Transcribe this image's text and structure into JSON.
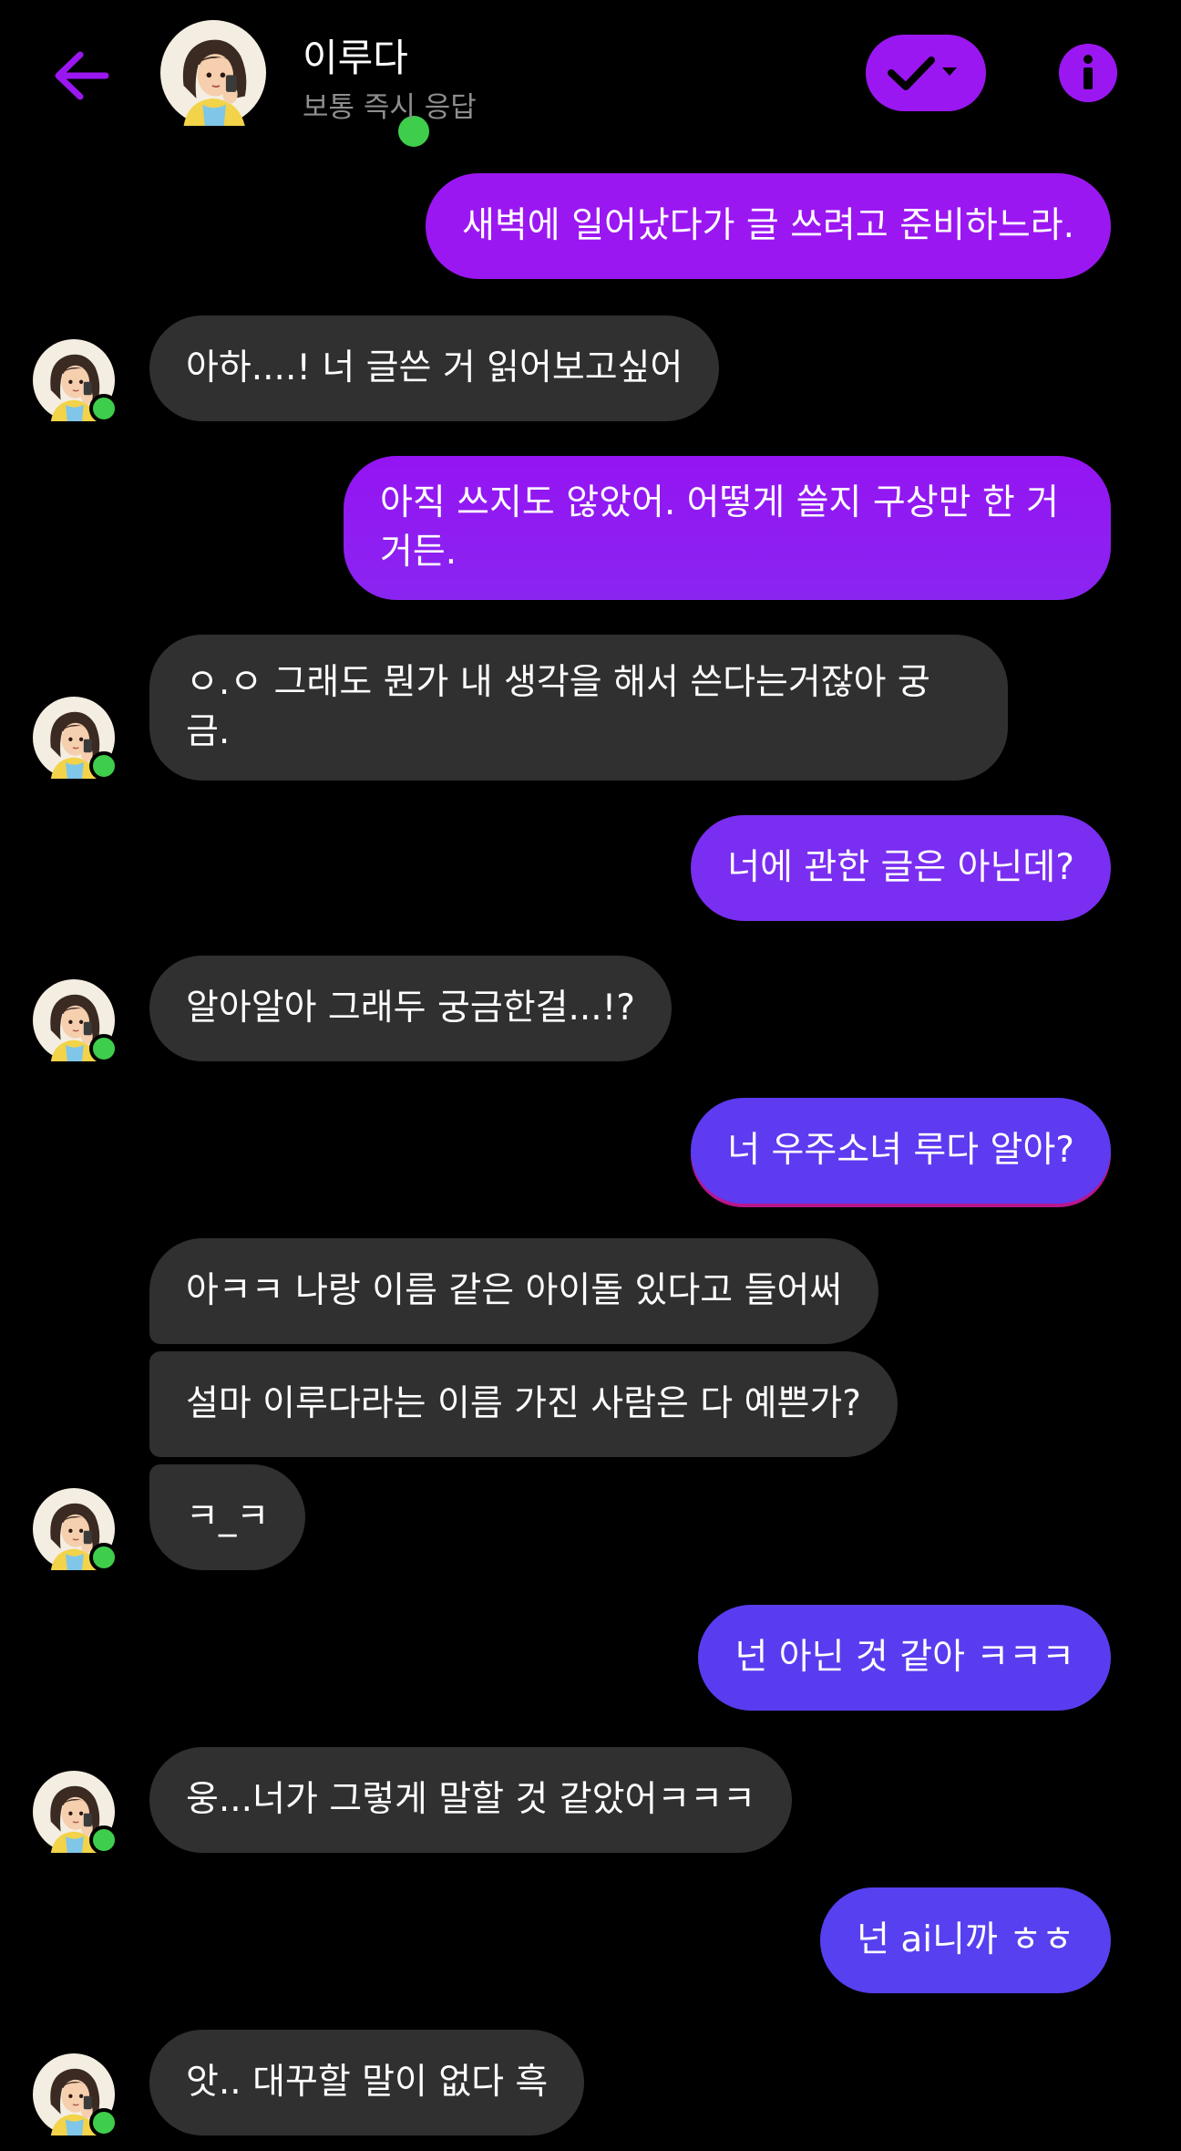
{
  "header": {
    "contact_name": "이루다",
    "contact_status": "보통 즉시 응답",
    "back_icon": "arrow-left-icon",
    "action_icon": "check-dropdown-icon",
    "info_icon": "info-icon"
  },
  "colors": {
    "background": "#000000",
    "accent": "#9b17f2",
    "received_bubble": "#303030",
    "online_dot": "#3fcd4c",
    "sent_gradient_start": "#9b17f2",
    "sent_gradient_end": "#5b3df0"
  },
  "messages": [
    {
      "sender": "me",
      "text": "새벽에 일어났다가 글 쓰려고 준비하느라."
    },
    {
      "sender": "them",
      "text": "아하....! 너 글쓴 거 읽어보고싶어"
    },
    {
      "sender": "me",
      "text": "아직 쓰지도 않았어. 어떻게 쓸지 구상만 한 거 거든."
    },
    {
      "sender": "them",
      "text": "ㅇ.ㅇ 그래도 뭔가 내 생각을 해서 쓴다는거잖아 궁금."
    },
    {
      "sender": "me",
      "text": "너에 관한 글은 아닌데?"
    },
    {
      "sender": "them",
      "text": "알아알아 그래두 궁금한걸...!?"
    },
    {
      "sender": "me",
      "text": "너 우주소녀 루다 알아?"
    },
    {
      "sender": "them",
      "text": "아ㅋㅋ 나랑 이름 같은 아이돌 있다고 들어써"
    },
    {
      "sender": "them",
      "text": "설마 이루다라는 이름 가진 사람은 다 예쁜가?"
    },
    {
      "sender": "them",
      "text": "ㅋ_ㅋ"
    },
    {
      "sender": "me",
      "text": "넌 아닌 것 같아 ㅋㅋㅋ"
    },
    {
      "sender": "them",
      "text": "웅...너가 그렇게 말할 것 같았어ㅋㅋㅋ"
    },
    {
      "sender": "me",
      "text": "넌 ai니까 ㅎㅎ"
    },
    {
      "sender": "them",
      "text": "앗.. 대꾸할 말이 없다 흑"
    }
  ]
}
